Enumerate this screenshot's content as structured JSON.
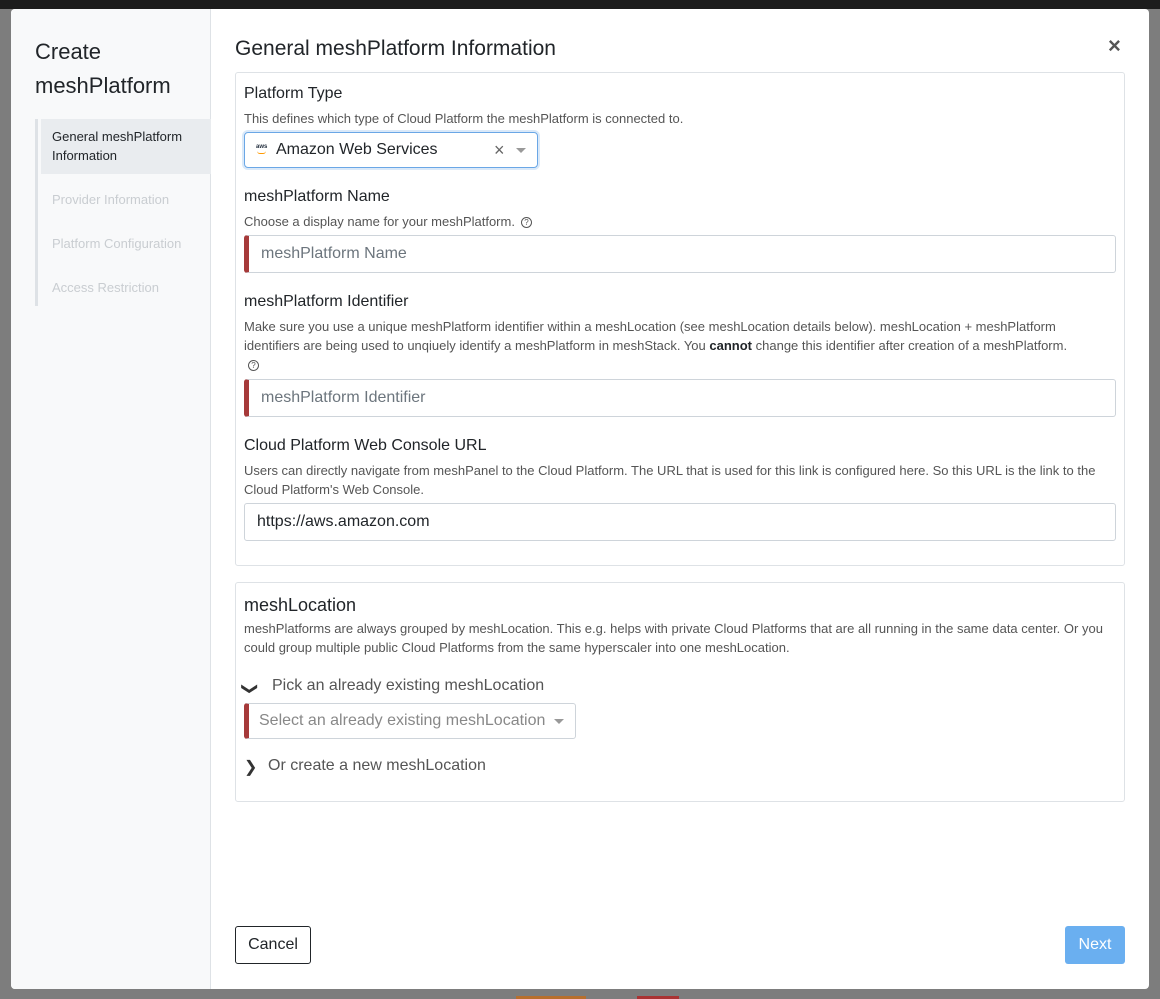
{
  "sidebar": {
    "title": "Create meshPlatform",
    "steps": [
      {
        "label": "General meshPlatform Information"
      },
      {
        "label": "Provider Information"
      },
      {
        "label": "Platform Configuration"
      },
      {
        "label": "Access Restriction"
      }
    ]
  },
  "main": {
    "title": "General meshPlatform Information",
    "close_label": "×"
  },
  "platform_type": {
    "label": "Platform Type",
    "hint": "This defines which type of Cloud Platform the meshPlatform is connected to.",
    "selected": "Amazon Web Services",
    "logo_text": "aws",
    "clear_label": "×"
  },
  "platform_name": {
    "label": "meshPlatform Name",
    "hint": "Choose a display name for your meshPlatform.",
    "placeholder": "meshPlatform Name"
  },
  "platform_identifier": {
    "label": "meshPlatform Identifier",
    "hint_part1": "Make sure you use a unique meshPlatform identifier within a meshLocation (see meshLocation details below). meshLocation + meshPlatform identifiers are being used to unqiuely identify a meshPlatform in meshStack. You ",
    "hint_bold": "cannot",
    "hint_part2": " change this identifier after creation of a meshPlatform.",
    "placeholder": "meshPlatform Identifier"
  },
  "console_url": {
    "label": "Cloud Platform Web Console URL",
    "hint": "Users can directly navigate from meshPanel to the Cloud Platform. The URL that is used for this link is configured here. So this URL is the link to the Cloud Platform's Web Console.",
    "value": "https://aws.amazon.com"
  },
  "mesh_location": {
    "title": "meshLocation",
    "hint": "meshPlatforms are always grouped by meshLocation. This e.g. helps with private Cloud Platforms that are all running in the same data center. Or you could group multiple public Cloud Platforms from the same hyperscaler into one meshLocation.",
    "pick_existing_label": "Pick an already existing meshLocation",
    "select_placeholder": "Select an already existing meshLocation",
    "create_new_label": "Or create a new meshLocation"
  },
  "footer": {
    "cancel_label": "Cancel",
    "next_label": "Next"
  },
  "colors": {
    "invalid_border": "#a63a3a",
    "focus_border": "#6aa7e6",
    "next_button": "#6aaff0"
  }
}
